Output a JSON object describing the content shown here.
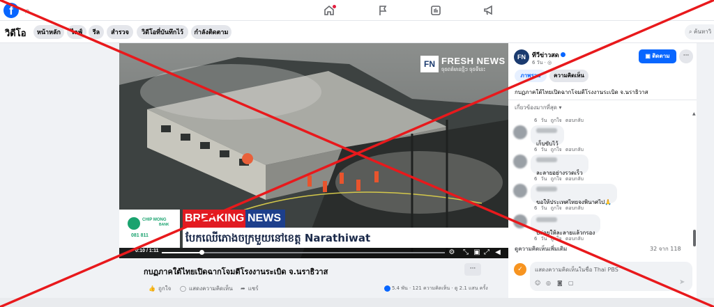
{
  "colors": {
    "brand": "#0866ff",
    "cross": "#e8191c",
    "breaking_red": "#e11b22",
    "breaking_blue": "#1d3f8c",
    "sponsor_green": "#1aa36f"
  },
  "topbar": {
    "logo": "f",
    "icons": [
      "search-icon",
      "home-icon",
      "flag-icon",
      "marketplace-icon",
      "megaphone-icon"
    ]
  },
  "subnav": {
    "title": "วิดีโอ",
    "chips": [
      "หน้าหลัก",
      "ไลฟ์",
      "รีล",
      "สำรวจ",
      "วิดีโอที่บันทึกไว้",
      "กำลังติดตาม"
    ],
    "search_placeholder": "ค้นหาวิ"
  },
  "video": {
    "watermark_logo": "FN",
    "watermark_name": "FRESH NEWS",
    "watermark_sub": "ចុចពត៌មានថ្មីៗ ចុចទីនេះ",
    "sponsor_name": "CHIP MONG",
    "sponsor_bank": "BANK",
    "sponsor_phone": "081 811",
    "breaking_word1": "BREAKING",
    "breaking_word2": "NEWS",
    "headline": "បែកឈើភោងចក្រមួយនៅខេត្ត Narathiwat",
    "time": "0:10 / 1:11",
    "progress": 0.14
  },
  "post": {
    "title": "กบฏภาคใต้ไทยเปิดฉากโจมตีโรงงานระเบิด จ.นราธิวาส",
    "more": "···",
    "actions": {
      "like": "ถูกใจ",
      "comment": "แสดงความคิดเห็น",
      "share": "แชร์"
    },
    "stats": "5.4 พัน · 121 ความคิดเห็น · ดู 2.1 แสน ครั้ง"
  },
  "panel": {
    "page_avatar": "FN",
    "page_name": "ทีวีข่าวสด",
    "page_meta": "6 วัน · ◎",
    "follow_label": "ติดตาม",
    "more": "···",
    "tabs": [
      "ภาพรวม",
      "ความคิดเห็น"
    ],
    "caption": "กบฏภาคใต้ไทยเปิดฉากโจมตีโรงงานระเบิด จ.นราธิวาส",
    "sort_label": "เกี่ยวข้องมากที่สุด ▾",
    "first_meta": "6 วัน   ถูกใจ   ตอบกลับ",
    "comments": [
      {
        "text": "เก็บขับไว้",
        "meta": "6 วัน   ถูกใจ   ตอบกลับ"
      },
      {
        "text": "ละลายอย่างรวดเร็ว",
        "meta": "6 วัน   ถูกใจ   ตอบกลับ"
      },
      {
        "text": "ขอให้ประเทศไทยจงพินาศไป🙏",
        "meta": "6 วัน   ถูกใจ   ตอบกลับ"
      },
      {
        "text": "ปล่อยให้ละลายแล้วกรอง",
        "meta": "6 วัน   ถูกใจ   ตอบกลับ"
      }
    ],
    "view_more": "ดูความคิดเห็นเพิ่มเติม",
    "count": "32 จาก 118",
    "composer_avatar": "✓",
    "composer_placeholder": "แสดงความคิดเห็นในชื่อ Thai PBS",
    "composer_icons": [
      "emoji-icon",
      "sticker-icon",
      "camera-icon",
      "gif-icon"
    ]
  }
}
